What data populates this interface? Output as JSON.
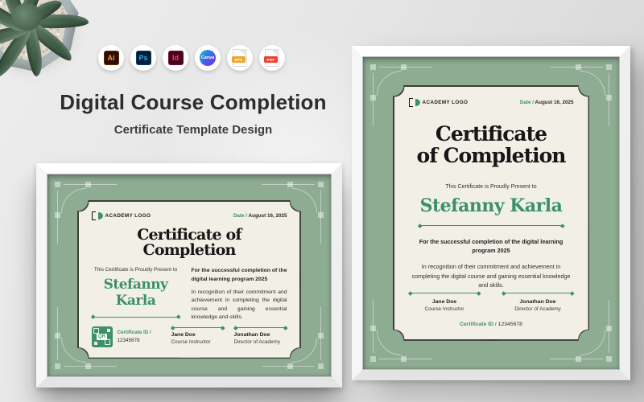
{
  "page": {
    "title": "Digital Course Completion",
    "subtitle": "Certificate Template Design"
  },
  "apps": {
    "illustrator": "Ai",
    "photoshop": "Ps",
    "indesign": "Id",
    "canva": "Canva",
    "eps": "EPS",
    "pdf": "PDF"
  },
  "certificate": {
    "logo_text": "ACADEMY LOGO",
    "date_label": "Date /",
    "date_value": "August 16, 2025",
    "title": "Certificate of Completion",
    "title_line1": "Certificate",
    "title_line2": "of Completion",
    "presented_label": "This Certificate is Proudly Present to",
    "recipient": "Stefanny Karla",
    "body_bold": "For the successful completion of the digital learning program 2025",
    "body_text": "In recognition of their commitment and achievement in completing the digital course and gaining essential knowledge and skills.",
    "qr_label": "QR",
    "cert_id_label": "Certificate ID /",
    "cert_id_value": "12345678",
    "signers": [
      {
        "name": "Jane Doe",
        "role": "Course Instructor"
      },
      {
        "name": "Jonathan Doe",
        "role": "Director of Academy"
      }
    ]
  },
  "colors": {
    "mat_green": "#8dac92",
    "panel_cream": "#f2efe6",
    "accent_green": "#3c9168",
    "ink": "#1f1f1f"
  }
}
